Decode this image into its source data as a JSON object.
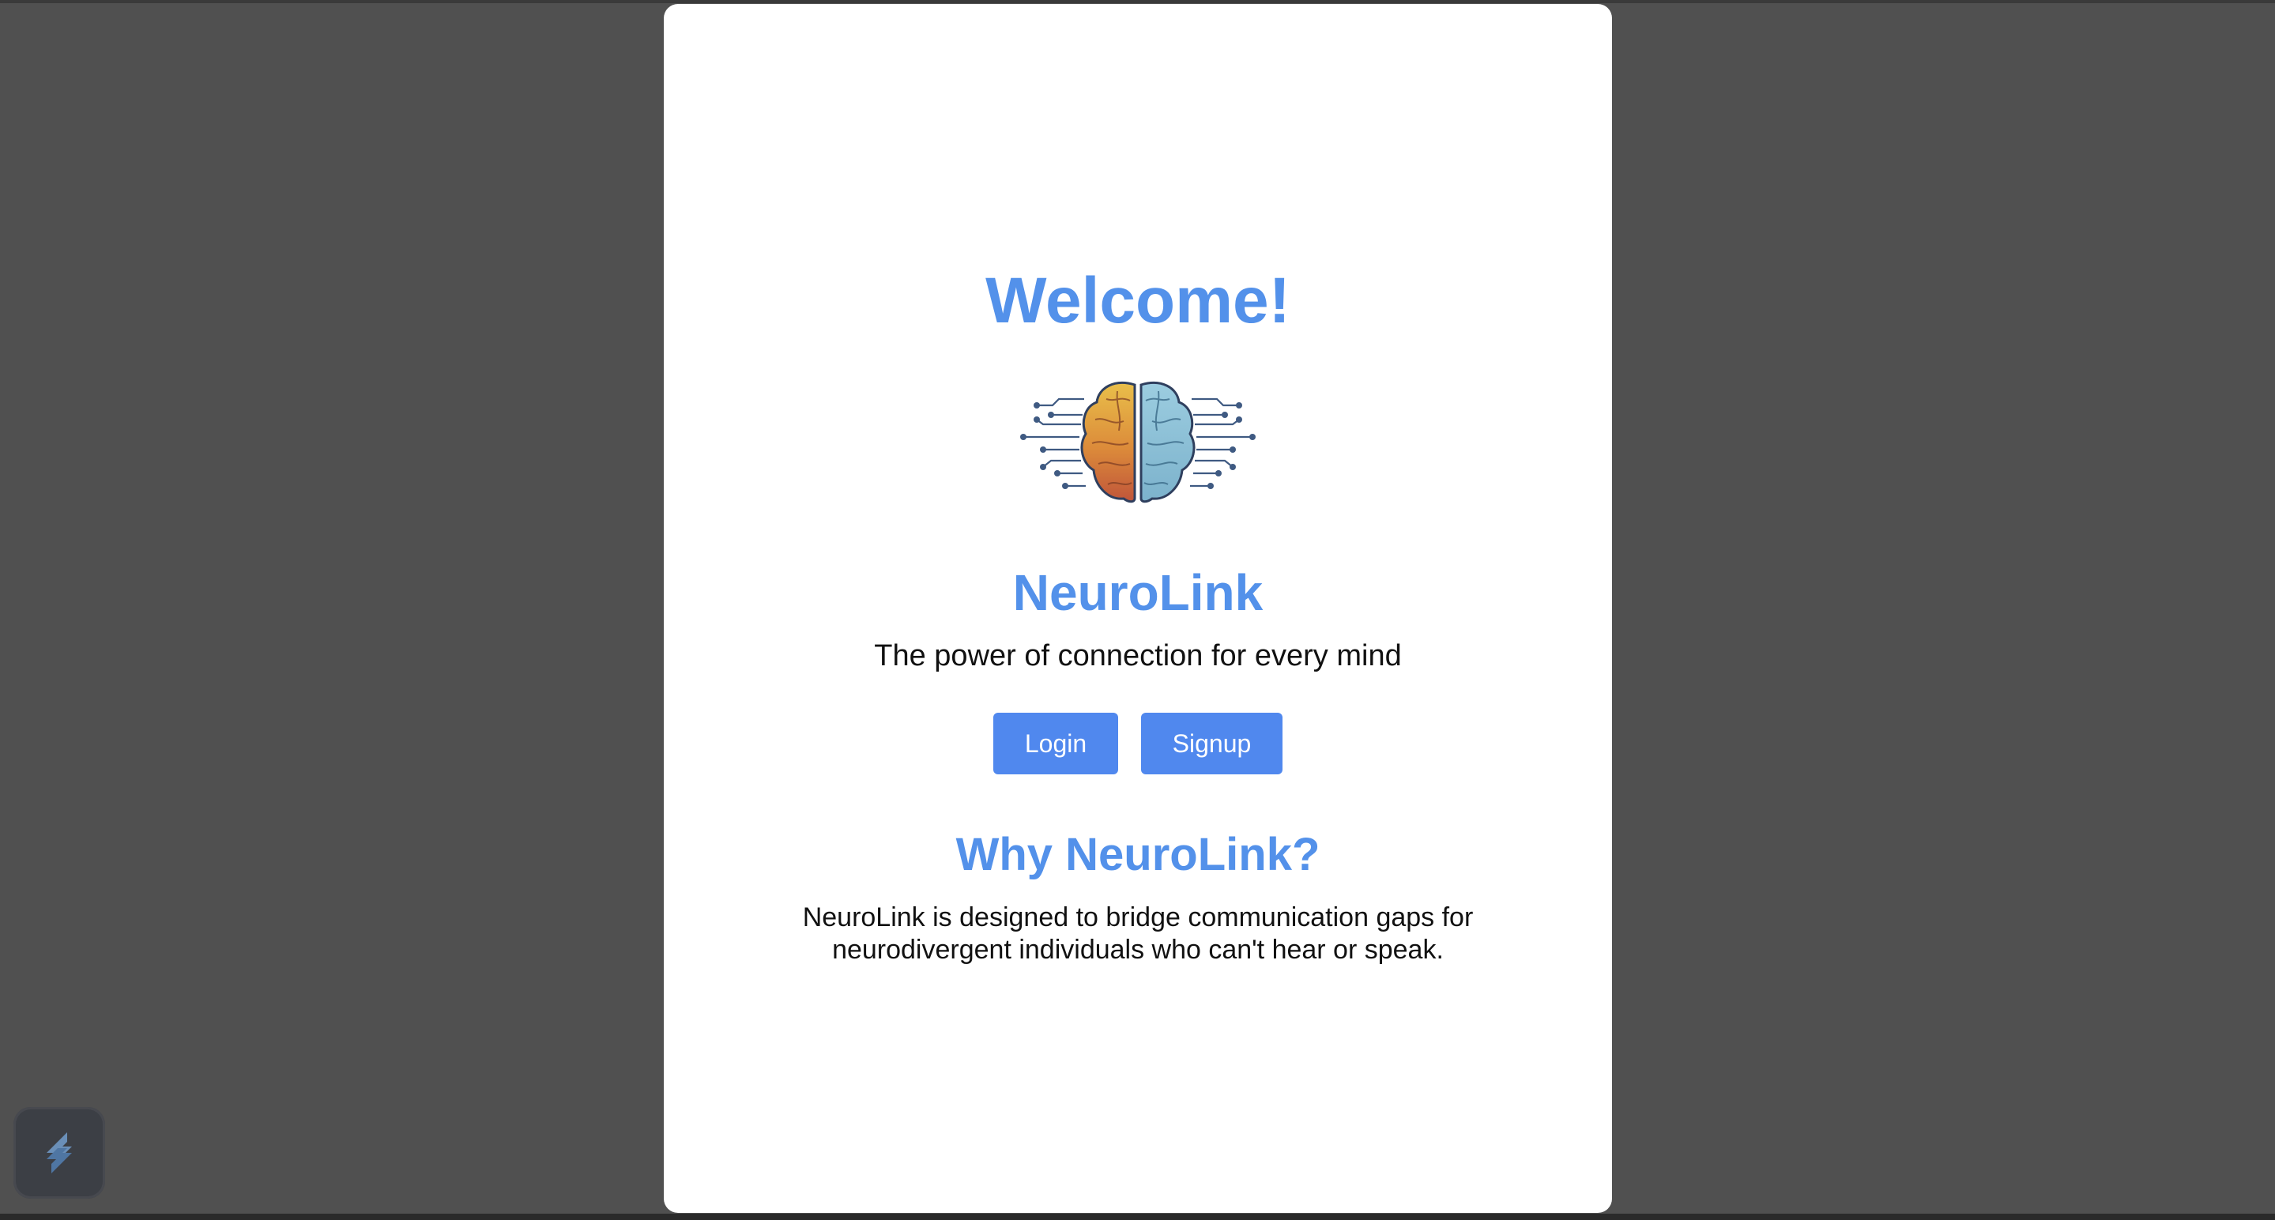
{
  "welcome": "Welcome!",
  "brand": "NeuroLink",
  "tagline": "The power of connection for every mind",
  "buttons": {
    "login": "Login",
    "signup": "Signup"
  },
  "why": {
    "title": "Why NeuroLink?",
    "line1": "NeuroLink is designed to bridge communication gaps for",
    "line2": "neurodivergent individuals who can't hear or speak."
  },
  "icons": {
    "logo": "brain-circuit-icon",
    "extension": "extension-s-icon"
  },
  "colors": {
    "accent": "#5391ea",
    "button": "#5088ee",
    "overlay": "#505050",
    "brain_left": "#d98a3a",
    "brain_right": "#8fc3d9"
  }
}
